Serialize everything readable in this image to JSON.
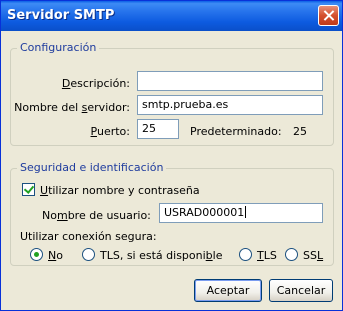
{
  "window": {
    "title": "Servidor SMTP"
  },
  "config": {
    "legend": "Configuración",
    "description": {
      "label_pre": "",
      "label_accel": "D",
      "label_post": "escripción:",
      "value": ""
    },
    "server": {
      "label_pre": "Nombre del ",
      "label_accel": "s",
      "label_post": "ervidor:",
      "value": "smtp.prueba.es"
    },
    "port": {
      "label_pre": "",
      "label_accel": "P",
      "label_post": "uerto:",
      "value": "25"
    },
    "default": {
      "label": "Predeterminado:",
      "value": "25"
    }
  },
  "security": {
    "legend": "Seguridad e identificación",
    "use_credentials": {
      "label_pre": "",
      "label_accel": "U",
      "label_post": "tilizar nombre y contraseña",
      "checked": true
    },
    "username": {
      "label_pre": "No",
      "label_accel": "m",
      "label_post": "bre de usuario:",
      "value": "USRAD000001"
    },
    "secure_label": "Utilizar conexión segura:",
    "options": [
      {
        "pre": "",
        "accel": "N",
        "post": "o",
        "checked": true
      },
      {
        "pre": "TLS, si está disponi",
        "accel": "b",
        "post": "le",
        "checked": false
      },
      {
        "pre": "",
        "accel": "T",
        "post": "LS",
        "checked": false
      },
      {
        "pre": "SS",
        "accel": "L",
        "post": "",
        "checked": false
      }
    ]
  },
  "buttons": {
    "ok": "Aceptar",
    "cancel": "Cancelar"
  }
}
